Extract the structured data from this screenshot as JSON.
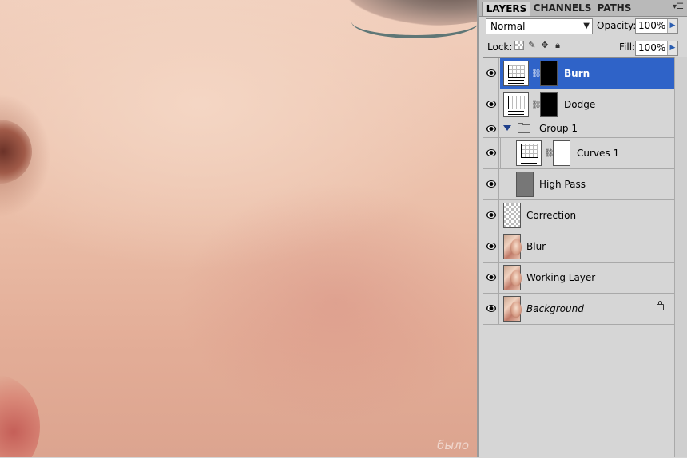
{
  "canvas": {
    "watermark": "было"
  },
  "panel": {
    "tabs": [
      {
        "label": "LAYERS",
        "active": true
      },
      {
        "label": "CHANNELS",
        "active": false
      },
      {
        "label": "PATHS",
        "active": false
      }
    ],
    "blend_mode": "Normal",
    "opacity_label": "Opacity:",
    "opacity_value": "100%",
    "lock_label": "Lock:",
    "fill_label": "Fill:",
    "fill_value": "100%",
    "menu_icon": "panel-menu-icon"
  },
  "layers": [
    {
      "name": "Burn",
      "type": "adjustment-curves",
      "mask": "black",
      "selected": true,
      "visible": true
    },
    {
      "name": "Dodge",
      "type": "adjustment-curves",
      "mask": "black",
      "selected": false,
      "visible": true
    },
    {
      "name": "Group 1",
      "type": "group",
      "expanded": true,
      "visible": true
    },
    {
      "name": "Curves 1",
      "type": "adjustment-curves",
      "mask": "white",
      "in_group": true,
      "visible": true
    },
    {
      "name": "High Pass",
      "type": "pixel-gray",
      "in_group": true,
      "visible": true
    },
    {
      "name": "Correction",
      "type": "pixel-transparent",
      "visible": true
    },
    {
      "name": "Blur",
      "type": "pixel-photo",
      "visible": true
    },
    {
      "name": "Working Layer",
      "type": "pixel-photo",
      "visible": true
    },
    {
      "name": "Background",
      "type": "pixel-photo",
      "locked": true,
      "visible": true
    }
  ]
}
